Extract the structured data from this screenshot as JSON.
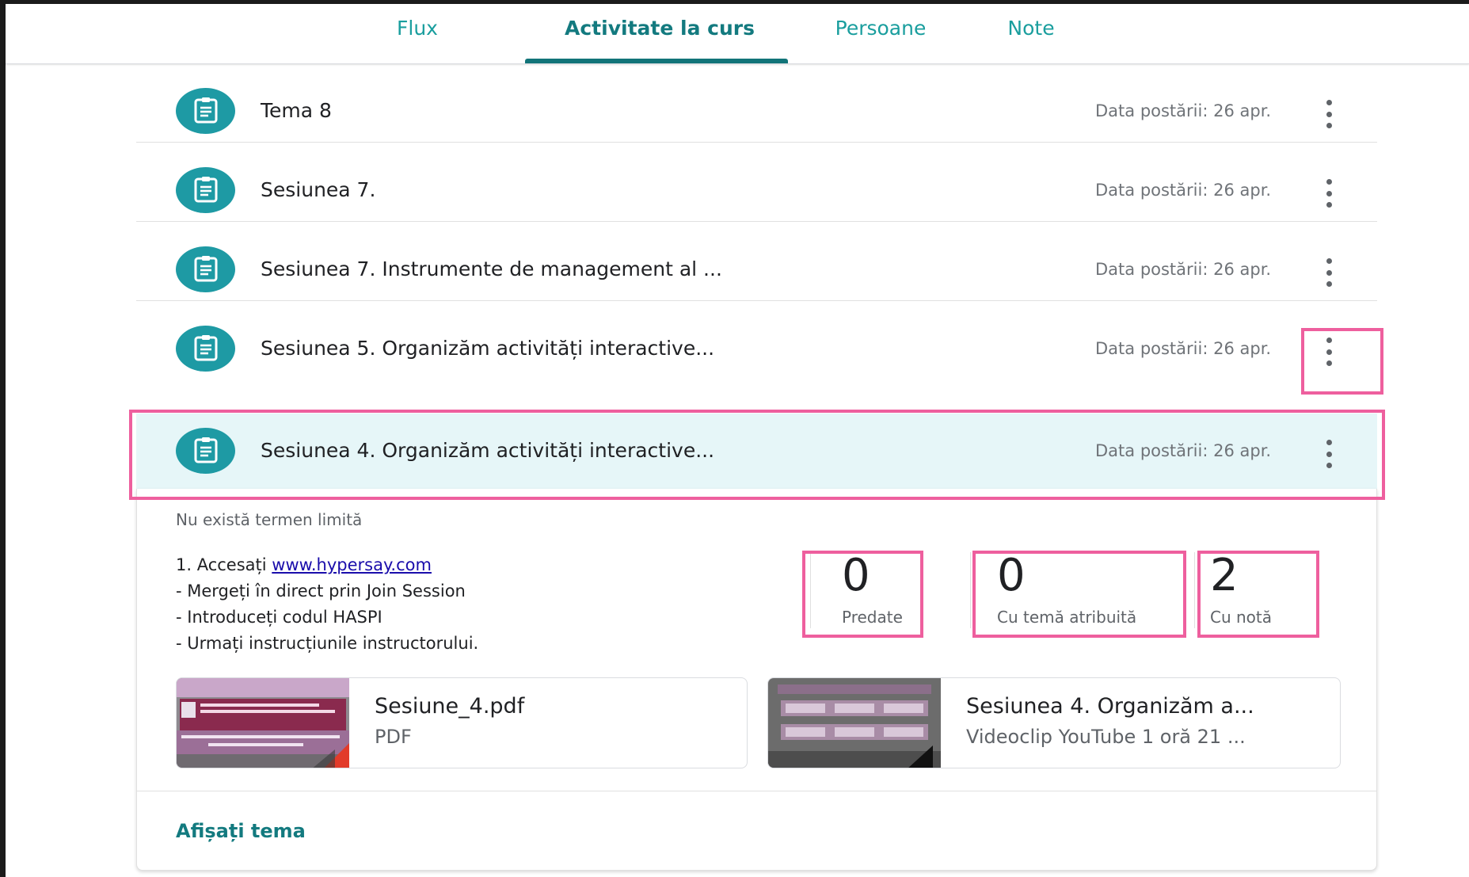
{
  "tabs": [
    {
      "label": "Flux"
    },
    {
      "label": "Activitate la curs"
    },
    {
      "label": "Persoane"
    },
    {
      "label": "Note"
    }
  ],
  "items": [
    {
      "title": "Tema 8",
      "date": "Data postării: 26 apr."
    },
    {
      "title": "Sesiunea 7.",
      "date": "Data postării: 26 apr."
    },
    {
      "title": "Sesiunea 7. Instrumente de management al ...",
      "date": "Data postării: 26 apr."
    },
    {
      "title": "Sesiunea 5. Organizăm activități interactive...",
      "date": "Data postării: 26 apr."
    },
    {
      "title": "Sesiunea 4. Organizăm activități interactive...",
      "date": "Data postării: 26 apr."
    }
  ],
  "expanded": {
    "deadline": "Nu există termen limită",
    "instructions": {
      "line1_prefix": "1. Accesați ",
      "line1_link": "www.hypersay.com",
      "line2": "- Mergeți în direct prin Join Session",
      "line3": "- Introduceți codul HASPI",
      "line4": "- Urmați instrucțiunile instructorului."
    },
    "stats": [
      {
        "value": "0",
        "label": "Predate"
      },
      {
        "value": "0",
        "label": "Cu temă atribuită"
      },
      {
        "value": "2",
        "label": "Cu notă"
      }
    ],
    "attachments": [
      {
        "title": "Sesiune_4.pdf",
        "subtitle": "PDF"
      },
      {
        "title": "Sesiunea 4. Organizăm a...",
        "subtitle": "Videoclip YouTube   1 oră 21 ..."
      }
    ],
    "show_link": "Afișați tema"
  },
  "colors": {
    "accent": "#137a7f",
    "icon_bg": "#1e9aa4",
    "highlight": "#ee5f9e",
    "selected_row_bg": "#e6f6f8"
  }
}
